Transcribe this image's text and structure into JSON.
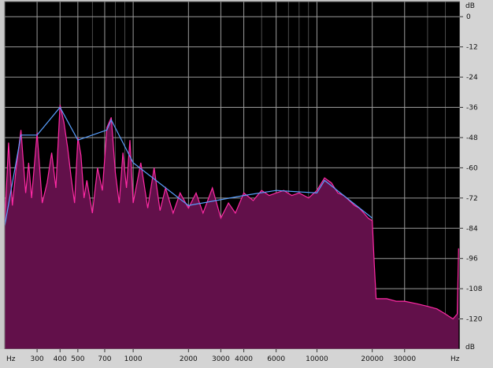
{
  "chart_data": {
    "type": "area",
    "title": "",
    "xscale": "log",
    "xlim": [
      200,
      60000
    ],
    "ylim": [
      -132,
      6
    ],
    "x_unit_label": "Hz",
    "y_unit_label": "dB",
    "x_ticks": [
      {
        "value": 300,
        "label": "300"
      },
      {
        "value": 400,
        "label": "400"
      },
      {
        "value": 500,
        "label": "500"
      },
      {
        "value": 700,
        "label": "700"
      },
      {
        "value": 1000,
        "label": "1000"
      },
      {
        "value": 2000,
        "label": "2000"
      },
      {
        "value": 3000,
        "label": "3000"
      },
      {
        "value": 4000,
        "label": "4000"
      },
      {
        "value": 6000,
        "label": "6000"
      },
      {
        "value": 10000,
        "label": "10000"
      },
      {
        "value": 20000,
        "label": "20000"
      },
      {
        "value": 30000,
        "label": "30000"
      }
    ],
    "y_ticks": [
      {
        "value": 0,
        "label": "0"
      },
      {
        "value": -12,
        "label": "-12"
      },
      {
        "value": -24,
        "label": "-24"
      },
      {
        "value": -36,
        "label": "-36"
      },
      {
        "value": -48,
        "label": "-48"
      },
      {
        "value": -60,
        "label": "-60"
      },
      {
        "value": -72,
        "label": "-72"
      },
      {
        "value": -84,
        "label": "-84"
      },
      {
        "value": -96,
        "label": "-96"
      },
      {
        "value": -108,
        "label": "-108"
      },
      {
        "value": -120,
        "label": "-120"
      }
    ],
    "grid": true,
    "series": [
      {
        "color": "#ff2aa5",
        "fill": "#62104a",
        "x": [
          200,
          210,
          220,
          230,
          245,
          260,
          270,
          280,
          300,
          320,
          340,
          360,
          380,
          400,
          420,
          440,
          460,
          480,
          500,
          520,
          540,
          560,
          600,
          640,
          680,
          720,
          760,
          800,
          840,
          880,
          920,
          960,
          1000,
          1100,
          1200,
          1300,
          1400,
          1500,
          1650,
          1800,
          2000,
          2200,
          2400,
          2700,
          3000,
          3300,
          3600,
          4000,
          4500,
          5000,
          5500,
          6000,
          6600,
          7300,
          8000,
          9000,
          10000,
          11000,
          12000,
          13000,
          14000,
          15000,
          16000,
          17000,
          18000,
          19000,
          20000,
          20500,
          21000,
          24000,
          27000,
          30000,
          35000,
          40000,
          45000,
          50000,
          55000,
          58000,
          59000
        ],
        "y": [
          -82,
          -50,
          -75,
          -61,
          -45,
          -70,
          -58,
          -72,
          -46,
          -74,
          -66,
          -54,
          -68,
          -35,
          -42,
          -52,
          -64,
          -74,
          -48,
          -55,
          -72,
          -65,
          -78,
          -60,
          -69,
          -44,
          -40,
          -62,
          -74,
          -54,
          -68,
          -49,
          -74,
          -58,
          -76,
          -60,
          -77,
          -68,
          -78,
          -70,
          -76,
          -70,
          -78,
          -68,
          -80,
          -74,
          -78,
          -70,
          -73,
          -69,
          -71,
          -70,
          -69,
          -71,
          -70,
          -72,
          -69,
          -64,
          -66,
          -70,
          -71,
          -73,
          -75,
          -76,
          -78,
          -80,
          -81,
          -98,
          -112,
          -112,
          -113,
          -113,
          -114,
          -115,
          -116,
          -118,
          -120,
          -118,
          -92
        ]
      },
      {
        "color": "#5aa0ff",
        "x": [
          200,
          245,
          300,
          400,
          500,
          720,
          760,
          1000,
          2000,
          4000,
          6000,
          10000,
          11000,
          20000
        ],
        "y": [
          -83,
          -47,
          -47,
          -36,
          -49,
          -45,
          -41,
          -58,
          -75,
          -71,
          -69,
          -70,
          -65,
          -80
        ]
      }
    ]
  }
}
